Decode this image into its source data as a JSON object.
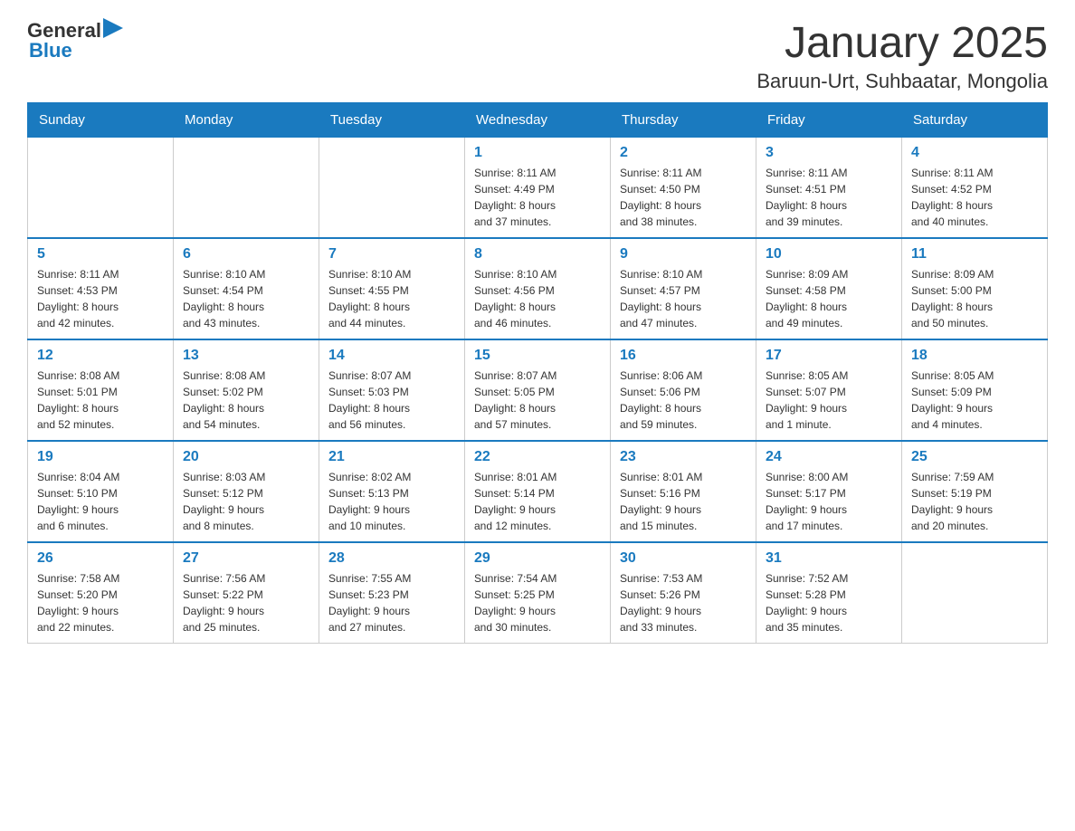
{
  "logo": {
    "general": "General",
    "blue": "Blue"
  },
  "title": "January 2025",
  "location": "Baruun-Urt, Suhbaatar, Mongolia",
  "days_of_week": [
    "Sunday",
    "Monday",
    "Tuesday",
    "Wednesday",
    "Thursday",
    "Friday",
    "Saturday"
  ],
  "weeks": [
    [
      {
        "day": "",
        "info": ""
      },
      {
        "day": "",
        "info": ""
      },
      {
        "day": "",
        "info": ""
      },
      {
        "day": "1",
        "info": "Sunrise: 8:11 AM\nSunset: 4:49 PM\nDaylight: 8 hours\nand 37 minutes."
      },
      {
        "day": "2",
        "info": "Sunrise: 8:11 AM\nSunset: 4:50 PM\nDaylight: 8 hours\nand 38 minutes."
      },
      {
        "day": "3",
        "info": "Sunrise: 8:11 AM\nSunset: 4:51 PM\nDaylight: 8 hours\nand 39 minutes."
      },
      {
        "day": "4",
        "info": "Sunrise: 8:11 AM\nSunset: 4:52 PM\nDaylight: 8 hours\nand 40 minutes."
      }
    ],
    [
      {
        "day": "5",
        "info": "Sunrise: 8:11 AM\nSunset: 4:53 PM\nDaylight: 8 hours\nand 42 minutes."
      },
      {
        "day": "6",
        "info": "Sunrise: 8:10 AM\nSunset: 4:54 PM\nDaylight: 8 hours\nand 43 minutes."
      },
      {
        "day": "7",
        "info": "Sunrise: 8:10 AM\nSunset: 4:55 PM\nDaylight: 8 hours\nand 44 minutes."
      },
      {
        "day": "8",
        "info": "Sunrise: 8:10 AM\nSunset: 4:56 PM\nDaylight: 8 hours\nand 46 minutes."
      },
      {
        "day": "9",
        "info": "Sunrise: 8:10 AM\nSunset: 4:57 PM\nDaylight: 8 hours\nand 47 minutes."
      },
      {
        "day": "10",
        "info": "Sunrise: 8:09 AM\nSunset: 4:58 PM\nDaylight: 8 hours\nand 49 minutes."
      },
      {
        "day": "11",
        "info": "Sunrise: 8:09 AM\nSunset: 5:00 PM\nDaylight: 8 hours\nand 50 minutes."
      }
    ],
    [
      {
        "day": "12",
        "info": "Sunrise: 8:08 AM\nSunset: 5:01 PM\nDaylight: 8 hours\nand 52 minutes."
      },
      {
        "day": "13",
        "info": "Sunrise: 8:08 AM\nSunset: 5:02 PM\nDaylight: 8 hours\nand 54 minutes."
      },
      {
        "day": "14",
        "info": "Sunrise: 8:07 AM\nSunset: 5:03 PM\nDaylight: 8 hours\nand 56 minutes."
      },
      {
        "day": "15",
        "info": "Sunrise: 8:07 AM\nSunset: 5:05 PM\nDaylight: 8 hours\nand 57 minutes."
      },
      {
        "day": "16",
        "info": "Sunrise: 8:06 AM\nSunset: 5:06 PM\nDaylight: 8 hours\nand 59 minutes."
      },
      {
        "day": "17",
        "info": "Sunrise: 8:05 AM\nSunset: 5:07 PM\nDaylight: 9 hours\nand 1 minute."
      },
      {
        "day": "18",
        "info": "Sunrise: 8:05 AM\nSunset: 5:09 PM\nDaylight: 9 hours\nand 4 minutes."
      }
    ],
    [
      {
        "day": "19",
        "info": "Sunrise: 8:04 AM\nSunset: 5:10 PM\nDaylight: 9 hours\nand 6 minutes."
      },
      {
        "day": "20",
        "info": "Sunrise: 8:03 AM\nSunset: 5:12 PM\nDaylight: 9 hours\nand 8 minutes."
      },
      {
        "day": "21",
        "info": "Sunrise: 8:02 AM\nSunset: 5:13 PM\nDaylight: 9 hours\nand 10 minutes."
      },
      {
        "day": "22",
        "info": "Sunrise: 8:01 AM\nSunset: 5:14 PM\nDaylight: 9 hours\nand 12 minutes."
      },
      {
        "day": "23",
        "info": "Sunrise: 8:01 AM\nSunset: 5:16 PM\nDaylight: 9 hours\nand 15 minutes."
      },
      {
        "day": "24",
        "info": "Sunrise: 8:00 AM\nSunset: 5:17 PM\nDaylight: 9 hours\nand 17 minutes."
      },
      {
        "day": "25",
        "info": "Sunrise: 7:59 AM\nSunset: 5:19 PM\nDaylight: 9 hours\nand 20 minutes."
      }
    ],
    [
      {
        "day": "26",
        "info": "Sunrise: 7:58 AM\nSunset: 5:20 PM\nDaylight: 9 hours\nand 22 minutes."
      },
      {
        "day": "27",
        "info": "Sunrise: 7:56 AM\nSunset: 5:22 PM\nDaylight: 9 hours\nand 25 minutes."
      },
      {
        "day": "28",
        "info": "Sunrise: 7:55 AM\nSunset: 5:23 PM\nDaylight: 9 hours\nand 27 minutes."
      },
      {
        "day": "29",
        "info": "Sunrise: 7:54 AM\nSunset: 5:25 PM\nDaylight: 9 hours\nand 30 minutes."
      },
      {
        "day": "30",
        "info": "Sunrise: 7:53 AM\nSunset: 5:26 PM\nDaylight: 9 hours\nand 33 minutes."
      },
      {
        "day": "31",
        "info": "Sunrise: 7:52 AM\nSunset: 5:28 PM\nDaylight: 9 hours\nand 35 minutes."
      },
      {
        "day": "",
        "info": ""
      }
    ]
  ]
}
